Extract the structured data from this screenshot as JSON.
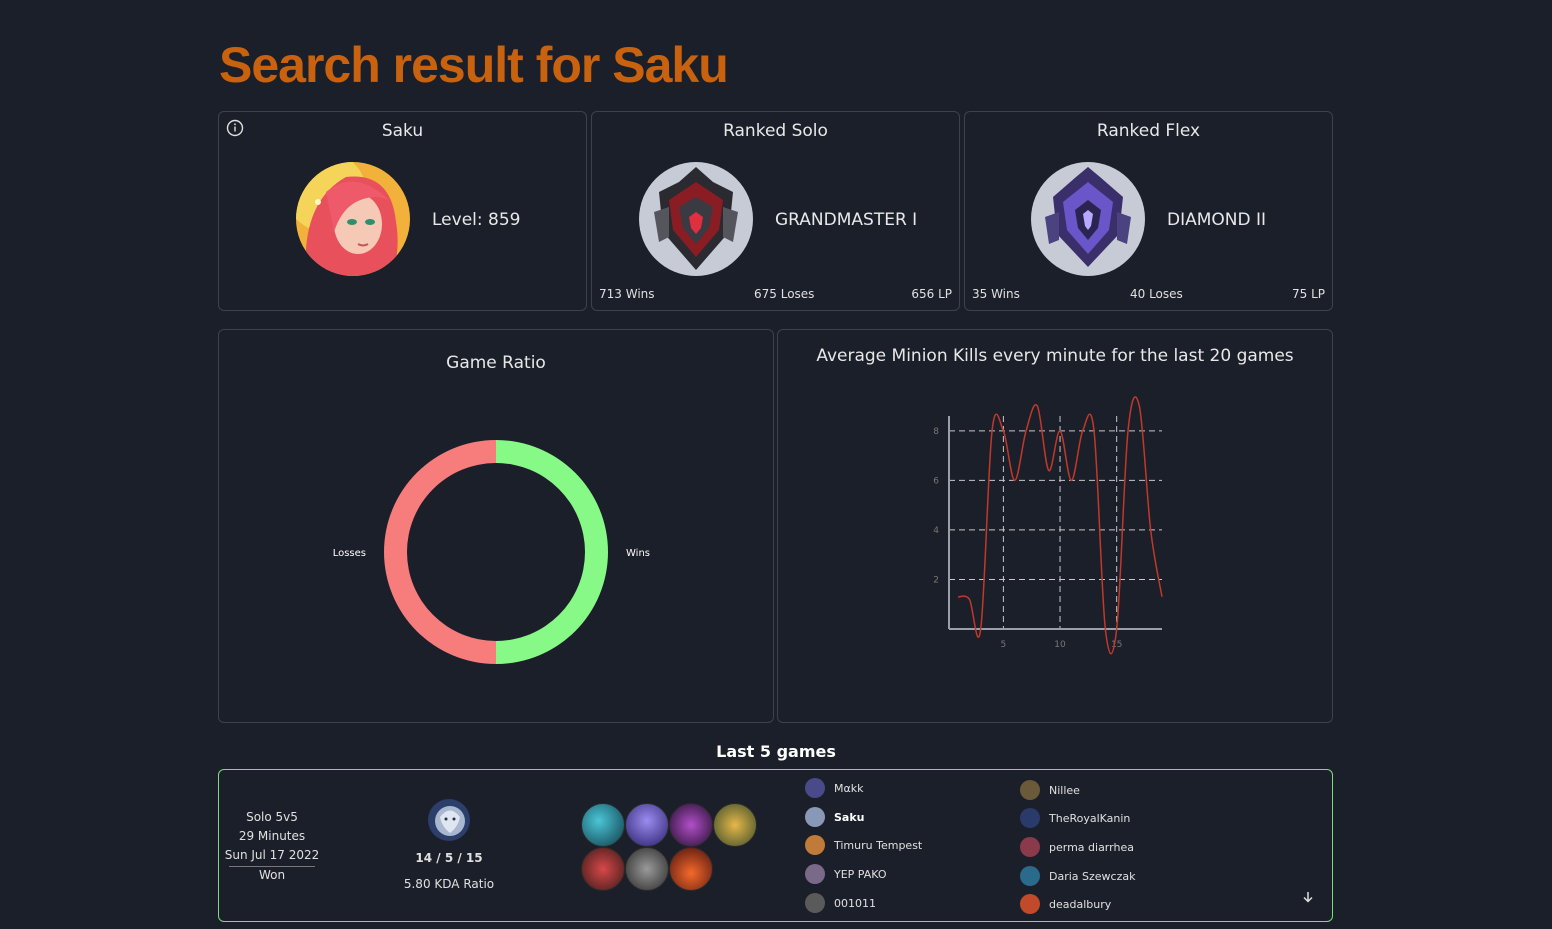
{
  "page": {
    "title": "Search result for Saku"
  },
  "profile": {
    "name": "Saku",
    "level": "Level: 859"
  },
  "ranked_solo": {
    "title": "Ranked Solo",
    "rank": "GRANDMASTER I",
    "wins": "713 Wins",
    "losses": "675 Loses",
    "lp": "656 LP"
  },
  "ranked_flex": {
    "title": "Ranked Flex",
    "rank": "DIAMOND II",
    "wins": "35 Wins",
    "losses": "40 Loses",
    "lp": "75 LP"
  },
  "game_ratio": {
    "title": "Game Ratio",
    "colors": {
      "wins": "#86f986",
      "losses": "#f77c7c"
    },
    "chart_data": {
      "type": "pie",
      "labels": [
        "Wins",
        "Losses"
      ],
      "values": [
        50,
        50
      ]
    }
  },
  "minion_chart": {
    "title": "Average Minion Kills every minute for the last 20 games",
    "chart_data": {
      "type": "line",
      "x": [
        1,
        2,
        3,
        4,
        5,
        6,
        7,
        8,
        9,
        10,
        11,
        12,
        13,
        14,
        15,
        16,
        17,
        18,
        19
      ],
      "y": [
        1.3,
        1.2,
        0,
        8,
        8,
        6,
        8,
        9,
        6.4,
        8,
        6,
        8,
        8,
        0,
        0,
        8,
        9,
        4,
        1.3
      ],
      "xticks": [
        5,
        10,
        15
      ],
      "yticks": [
        2,
        4,
        6,
        8
      ],
      "xlim": [
        0.2,
        19
      ],
      "ylim": [
        0,
        8.6
      ],
      "grid": true,
      "color": "#c0392b"
    }
  },
  "games": {
    "title": "Last 5 games",
    "list": [
      {
        "mode": "Solo 5v5",
        "duration": "29 Minutes",
        "date": "Sun Jul 17 2022",
        "result": "Won",
        "kda": "14 / 5 / 15",
        "kda_ratio": "5.80 KDA Ratio",
        "team_blue": [
          "Mαkk",
          "Saku",
          "Timuru Tempest",
          "YEP PAKO",
          "001011"
        ],
        "team_red": [
          "Nillee",
          "TheRoyalKanin",
          "perma diarrhea",
          "Daria Szewczak",
          "deadalbury"
        ]
      }
    ]
  }
}
